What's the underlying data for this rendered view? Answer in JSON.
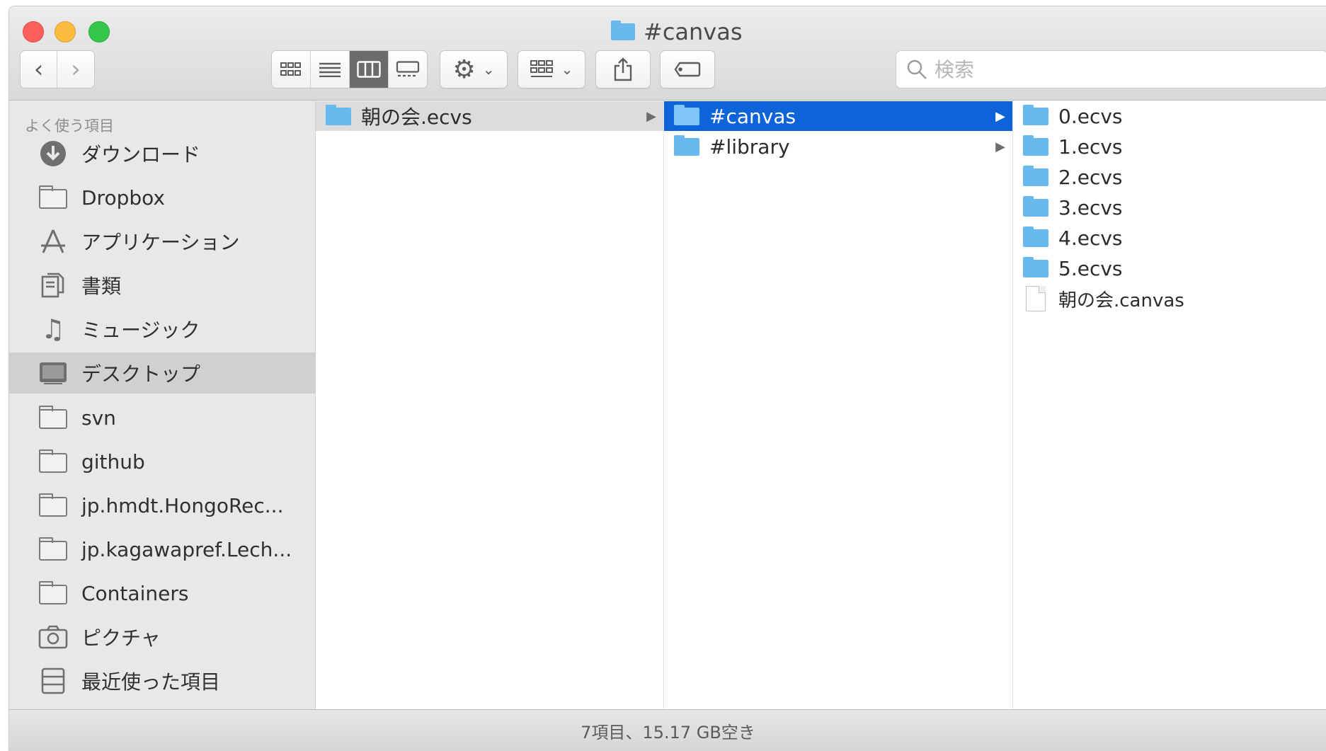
{
  "window": {
    "title": "#canvas"
  },
  "toolbar": {
    "back_label": "‹",
    "forward_label": "›",
    "search_placeholder": "検索"
  },
  "sidebar": {
    "header": "よく使う項目",
    "items": [
      {
        "label": "ダウンロード",
        "icon": "download-icon"
      },
      {
        "label": "Dropbox",
        "icon": "folder-icon"
      },
      {
        "label": "アプリケーション",
        "icon": "applications-icon"
      },
      {
        "label": "書類",
        "icon": "documents-icon"
      },
      {
        "label": "ミュージック",
        "icon": "music-icon"
      },
      {
        "label": "デスクトップ",
        "icon": "desktop-icon",
        "selected": true
      },
      {
        "label": "svn",
        "icon": "folder-icon"
      },
      {
        "label": "github",
        "icon": "folder-icon"
      },
      {
        "label": "jp.hmdt.HongoRec...",
        "icon": "folder-icon"
      },
      {
        "label": "jp.kagawapref.Lech...",
        "icon": "folder-icon"
      },
      {
        "label": "Containers",
        "icon": "folder-icon"
      },
      {
        "label": "ピクチャ",
        "icon": "camera-icon"
      },
      {
        "label": "最近使った項目",
        "icon": "recents-icon"
      }
    ]
  },
  "columns": [
    {
      "items": [
        {
          "name": "朝の会.ecvs",
          "type": "folder",
          "state": "parent",
          "has_children": true
        }
      ]
    },
    {
      "items": [
        {
          "name": "#canvas",
          "type": "folder",
          "state": "selected",
          "has_children": true
        },
        {
          "name": "#library",
          "type": "folder",
          "has_children": true
        }
      ]
    },
    {
      "items": [
        {
          "name": "0.ecvs",
          "type": "folder"
        },
        {
          "name": "1.ecvs",
          "type": "folder"
        },
        {
          "name": "2.ecvs",
          "type": "folder"
        },
        {
          "name": "3.ecvs",
          "type": "folder"
        },
        {
          "name": "4.ecvs",
          "type": "folder"
        },
        {
          "name": "5.ecvs",
          "type": "folder"
        },
        {
          "name": "朝の会.canvas",
          "type": "file"
        }
      ]
    }
  ],
  "status": {
    "text": "7項目、15.17 GB空き"
  },
  "colors": {
    "selection": "#0d63d8",
    "folder": "#67b9ee",
    "sidebar_bg": "#e8e8e8"
  }
}
